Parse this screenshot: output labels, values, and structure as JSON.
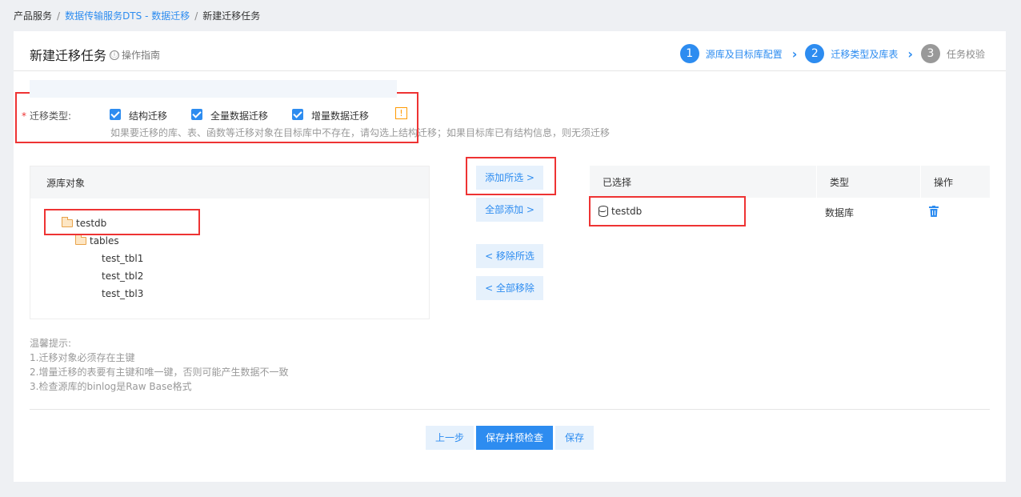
{
  "breadcrumb": {
    "item1": "产品服务",
    "item2": "数据传输服务DTS - 数据迁移",
    "item3": "新建迁移任务",
    "separator": "/"
  },
  "header": {
    "title": "新建迁移任务",
    "guide": "操作指南",
    "info_icon": "ⓘ"
  },
  "steps": [
    {
      "num": "1",
      "label": "源库及目标库配置",
      "state": "active"
    },
    {
      "num": "2",
      "label": "迁移类型及库表",
      "state": "active"
    },
    {
      "num": "3",
      "label": "任务校验",
      "state": "inactive"
    }
  ],
  "migration_type": {
    "required_mark": "*",
    "label": "迁移类型:",
    "options": [
      {
        "label": "结构迁移",
        "checked": true
      },
      {
        "label": "全量数据迁移",
        "checked": true
      },
      {
        "label": "增量数据迁移",
        "checked": true
      }
    ],
    "warning_icon": "!",
    "hint": "如果要迁移的库、表、函数等迁移对象在目标库中不存在，请勾选上结构迁移；如果目标库已有结构信息，则无须迁移"
  },
  "source_panel": {
    "header": "源库对象",
    "tree": {
      "db": "testdb",
      "folder": "tables",
      "tables": [
        "test_tbl1",
        "test_tbl2",
        "test_tbl3"
      ]
    }
  },
  "transfer_buttons": {
    "add_selected": "添加所选 >",
    "add_all": "全部添加 >",
    "remove_selected": "< 移除所选",
    "remove_all": "< 全部移除"
  },
  "selected_panel": {
    "columns": [
      "已选择",
      "类型",
      "操作"
    ],
    "rows": [
      {
        "name": "testdb",
        "type": "数据库",
        "action_icon": "trash-icon"
      }
    ]
  },
  "tips": {
    "title": "温馨提示:",
    "items": [
      "1.迁移对象必须存在主键",
      "2.增量迁移的表要有主键和唯一键，否则可能产生数据不一致",
      "3.检查源库的binlog是Raw Base格式"
    ]
  },
  "footer": {
    "prev": "上一步",
    "save_check": "保存并预检查",
    "save": "保存"
  },
  "colors": {
    "accent": "#2d8cf0",
    "highlight_box": "#e33",
    "warning": "#f90"
  }
}
